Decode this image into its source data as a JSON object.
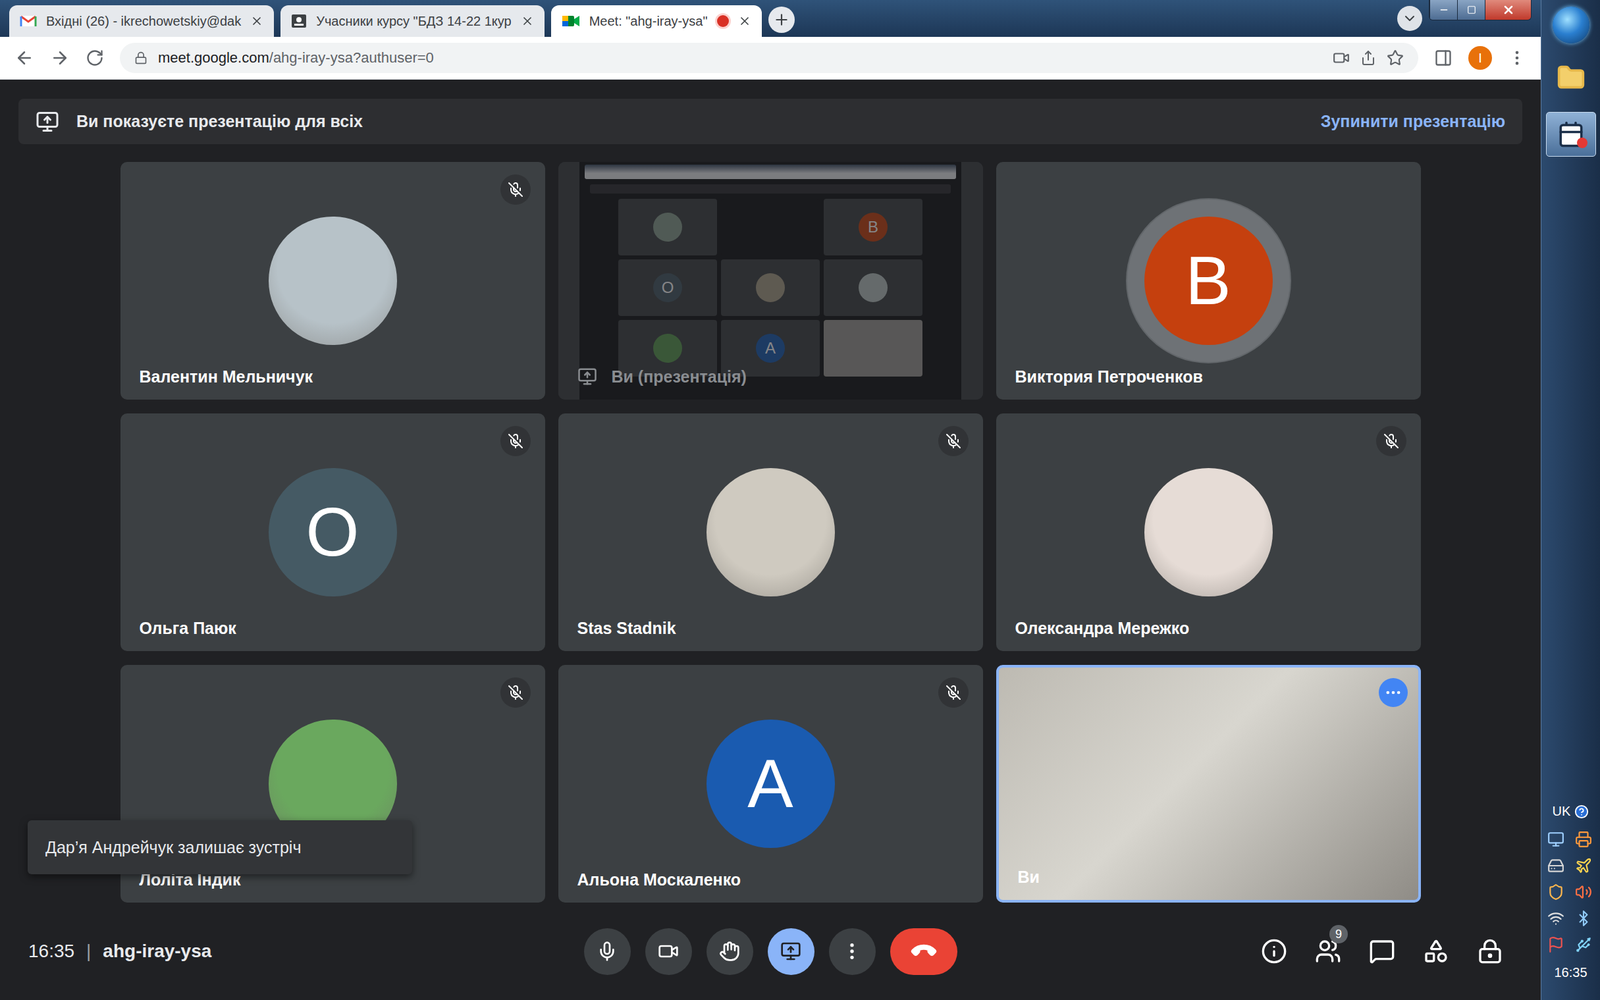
{
  "browser": {
    "tabs": [
      {
        "label": "Вхідні (26) - ikrechowetskiy@dak",
        "icon": "gmail",
        "selected": false,
        "recording": false
      },
      {
        "label": "Учасники курсу \"БДЗ 14-22 1кур",
        "icon": "classroom",
        "selected": false,
        "recording": false
      },
      {
        "label": "Meet: \"ahg-iray-ysa\"",
        "icon": "meet",
        "selected": true,
        "recording": true
      }
    ],
    "url_host": "meet.google.com",
    "url_path": "/ahg-iray-ysa?authuser=0",
    "profile": "I"
  },
  "banner": {
    "text": "Ви показуєте презентацію для всіх",
    "action": "Зупинити презентацію"
  },
  "tiles": [
    {
      "kind": "photo",
      "name": "Валентин Мельничук",
      "letter": "",
      "muted": true,
      "speaking": false,
      "highlighted": false,
      "color": "#b7c2c8"
    },
    {
      "kind": "presentation",
      "name": "Ви (презентація)",
      "letter": "",
      "muted": false,
      "speaking": false,
      "highlighted": false,
      "color": "#111214"
    },
    {
      "kind": "letter",
      "name": "Виктория Петроченков",
      "letter": "В",
      "muted": false,
      "speaking": true,
      "highlighted": false,
      "color": "#c5400e"
    },
    {
      "kind": "letter",
      "name": "Ольга Паюк",
      "letter": "О",
      "muted": true,
      "speaking": false,
      "highlighted": false,
      "color": "#455a64"
    },
    {
      "kind": "photo",
      "name": "Stas Stadnik",
      "letter": "",
      "muted": true,
      "speaking": false,
      "highlighted": false,
      "color": "#cfcac0"
    },
    {
      "kind": "photo",
      "name": "Олександра Мережко",
      "letter": "",
      "muted": true,
      "speaking": false,
      "highlighted": false,
      "color": "#e6dcd6"
    },
    {
      "kind": "photo",
      "name": "Лоліта Індик",
      "letter": "",
      "muted": true,
      "speaking": false,
      "highlighted": false,
      "color": "#6aa85e"
    },
    {
      "kind": "letter",
      "name": "Альона Москаленко",
      "letter": "А",
      "muted": true,
      "speaking": false,
      "highlighted": false,
      "color": "#1a5bb0"
    },
    {
      "kind": "video",
      "name": "Ви",
      "letter": "",
      "muted": false,
      "speaking": false,
      "highlighted": true,
      "color": "#bdbab2"
    }
  ],
  "thumbnail": [
    {
      "kind": "photo",
      "letter": "",
      "color": "#8aa090"
    },
    {
      "kind": "presentation",
      "letter": "",
      "color": "#111214"
    },
    {
      "kind": "letter",
      "letter": "В",
      "color": "#c5400e"
    },
    {
      "kind": "letter",
      "letter": "О",
      "color": "#455a64"
    },
    {
      "kind": "photo",
      "letter": "",
      "color": "#a89f88"
    },
    {
      "kind": "photo",
      "letter": "",
      "color": "#b8c4c0"
    },
    {
      "kind": "photo",
      "letter": "",
      "color": "#5a9a50"
    },
    {
      "kind": "letter",
      "letter": "А",
      "color": "#1a5bb0"
    },
    {
      "kind": "video",
      "letter": "",
      "color": "#9c9a94"
    }
  ],
  "toast": "Дар’я Андрейчук залишає зустріч",
  "bottom_bar": {
    "time": "16:35",
    "separator": "|",
    "meeting_code": "ahg-iray-ysa",
    "controls": [
      {
        "kind": "mic",
        "selected": false
      },
      {
        "kind": "camera",
        "selected": false
      },
      {
        "kind": "hand",
        "selected": false
      },
      {
        "kind": "present",
        "selected": true
      },
      {
        "kind": "more",
        "selected": false
      },
      {
        "kind": "leave",
        "selected": false
      }
    ],
    "side_buttons": [
      {
        "kind": "info",
        "badge": ""
      },
      {
        "kind": "people",
        "badge": "9"
      },
      {
        "kind": "chat",
        "badge": ""
      },
      {
        "kind": "activities",
        "badge": ""
      },
      {
        "kind": "host",
        "badge": ""
      }
    ]
  },
  "taskbar": {
    "language": "UK",
    "clock": "16:35"
  }
}
